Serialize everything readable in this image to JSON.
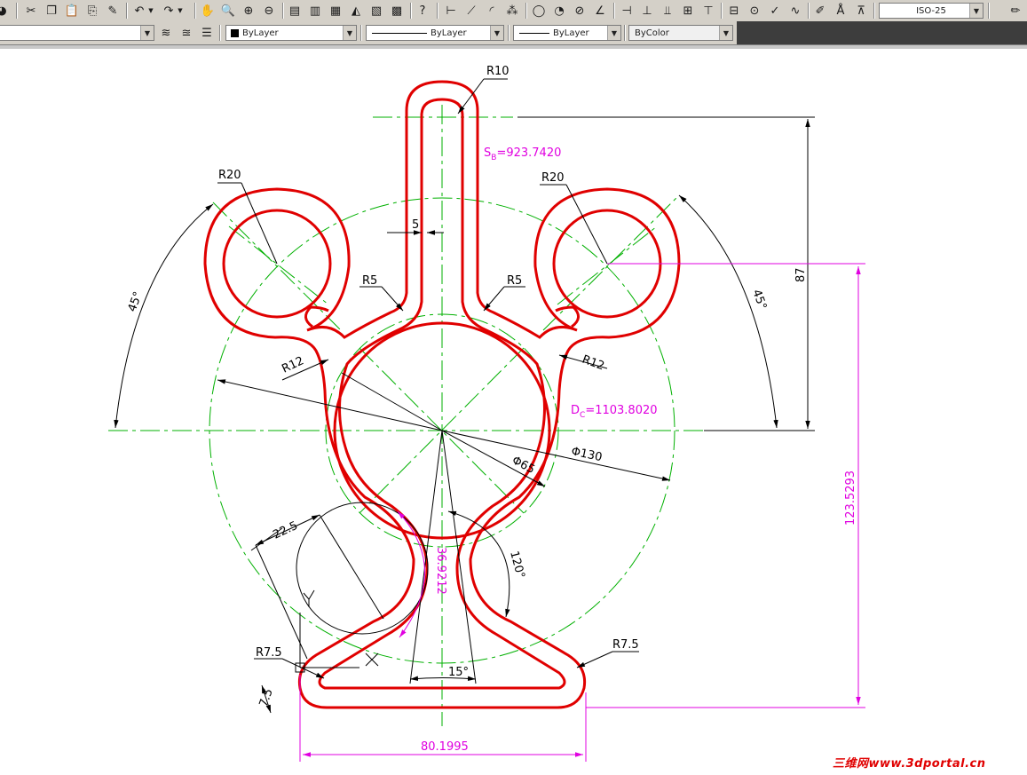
{
  "toolbar": {
    "text_style": "ISO-25",
    "layer": "",
    "color": "ByLayer",
    "linetype": "ByLayer",
    "lineweight": "ByLayer",
    "plotstyle": "ByColor"
  },
  "icons": [
    "cut-icon",
    "copy-icon",
    "paste-icon",
    "match-properties-icon",
    "undo-icon",
    "redo-icon",
    "pan-icon",
    "zoom-icon",
    "dimension-icon",
    "text-style-icon"
  ],
  "dims": {
    "r10": "R10",
    "sb": "S",
    "sb_sub": "B",
    "sb_val": "=923.7420",
    "r20_left": "R20",
    "r20_right": "R20",
    "d5": "5",
    "r5_left": "R5",
    "r5_right": "R5",
    "a45_left": "45°",
    "a45_right": "45°",
    "d87": "87",
    "r12_left": "R12",
    "r12_right": "R12",
    "dc": "D",
    "dc_sub": "C",
    "dc_val": "=1103.8020",
    "phi130": "Φ130",
    "phi65": "Φ65",
    "d225": "22.5",
    "a36": "36.9212",
    "a120": "120°",
    "d1235": "123.5293",
    "r75_left": "R7.5",
    "r75_right": "R7.5",
    "d75": "7.5",
    "a15": "15°",
    "d801": "80.1995"
  },
  "watermark": "三维网www.3dportal.cn",
  "colors": {
    "outline": "#e00000",
    "center": "#00b000",
    "dim": "#000000",
    "magenta": "#e000e0"
  }
}
